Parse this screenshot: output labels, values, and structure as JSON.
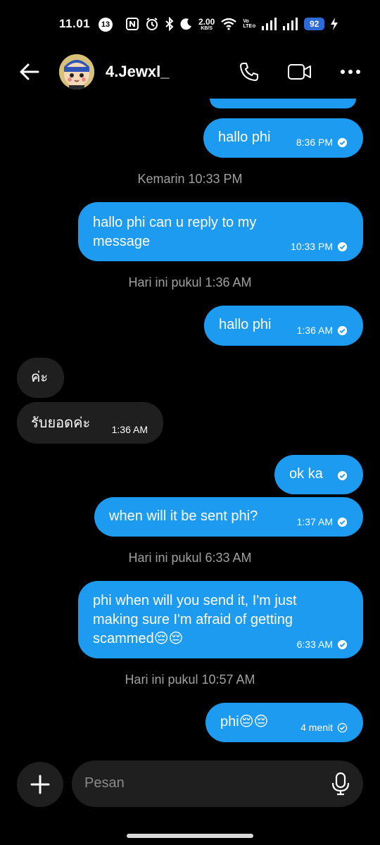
{
  "status_bar": {
    "time": "11.01",
    "notification_count": "13",
    "net_speed_value": "2.00",
    "net_speed_unit": "KB/S",
    "volte_top": "Vo",
    "volte_bottom": "LTE⊙",
    "battery": "92"
  },
  "header": {
    "contact_name": "4.Jewxl_"
  },
  "messages": [
    {
      "text": "hallo phi",
      "time": "8:36 PM"
    },
    {
      "stamp": "Kemarin 10:33 PM"
    },
    {
      "text_line1": "hallo phi can u reply to my",
      "text_line2": "message",
      "time": "10:33 PM"
    },
    {
      "stamp": "Hari ini pukul 1:36 AM"
    },
    {
      "text": "hallo phi",
      "time": "1:36 AM"
    },
    {
      "text": "ค่ะ"
    },
    {
      "text": "รับยอดค่ะ",
      "time": "1:36 AM"
    },
    {
      "text": "ok ka"
    },
    {
      "text": "when will it be sent phi?",
      "time": "1:37 AM"
    },
    {
      "stamp": "Hari ini pukul 6:33 AM"
    },
    {
      "text_line1": "phi when will you send it, I'm just",
      "text_line2": "making sure I'm afraid of getting",
      "text_line3": "scammed😔😔",
      "time": "6:33 AM"
    },
    {
      "stamp": "Hari ini pukul 10:57 AM"
    },
    {
      "text": "phi😔😔",
      "time": "4 menit"
    }
  ],
  "composer": {
    "placeholder": "Pesan"
  },
  "colors": {
    "outgoing_bubble": "#1d9bf0",
    "incoming_bubble": "#1f1f1f",
    "background": "#000000",
    "timestamp_text": "#a0a0a0"
  },
  "icons": [
    "back-arrow-icon",
    "phone-icon",
    "video-camera-icon",
    "more-icon",
    "plus-icon",
    "microphone-icon",
    "read-check-icon",
    "sent-check-icon"
  ]
}
